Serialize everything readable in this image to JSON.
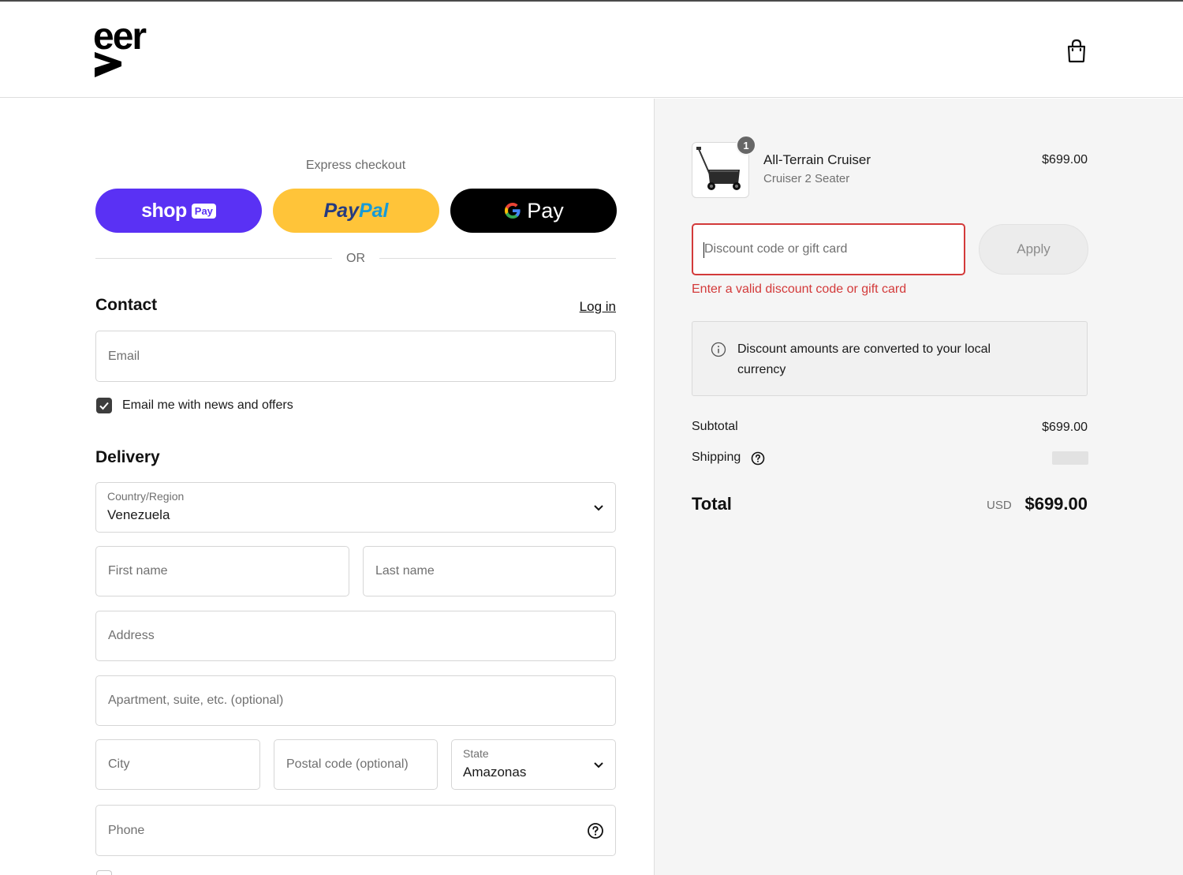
{
  "header": {
    "logo_text": "veer",
    "cart_icon": "shopping-bag-icon"
  },
  "express": {
    "title": "Express checkout",
    "shop_pay": {
      "word": "shop",
      "badge": "Pay",
      "color": "#5a31f4"
    },
    "paypal": {
      "part1": "Pay",
      "part2": "Pal",
      "color": "#ffc439"
    },
    "gpay": {
      "word": "Pay",
      "color": "#000000"
    },
    "divider_text": "OR"
  },
  "contact": {
    "title": "Contact",
    "login_link": "Log in",
    "email_placeholder": "Email",
    "newsletter_label": "Email me with news and offers",
    "newsletter_checked": true
  },
  "delivery": {
    "title": "Delivery",
    "country_label": "Country/Region",
    "country_value": "Venezuela",
    "first_name_placeholder": "First name",
    "last_name_placeholder": "Last name",
    "address_placeholder": "Address",
    "apartment_placeholder": "Apartment, suite, etc. (optional)",
    "city_placeholder": "City",
    "postal_placeholder": "Postal code (optional)",
    "state_label": "State",
    "state_value": "Amazonas",
    "phone_placeholder": "Phone"
  },
  "summary": {
    "product": {
      "name": "All-Terrain Cruiser",
      "variant": "Cruiser 2 Seater",
      "price": "$699.00",
      "quantity": "1"
    },
    "discount": {
      "placeholder": "Discount code or gift card",
      "apply_label": "Apply",
      "error": "Enter a valid discount code or gift card"
    },
    "info": "Discount amounts are converted to your local currency",
    "subtotal_label": "Subtotal",
    "subtotal_value": "$699.00",
    "shipping_label": "Shipping",
    "total_label": "Total",
    "total_currency": "USD",
    "total_value": "$699.00"
  },
  "colors": {
    "error": "#d33a3a",
    "summary_bg": "#f5f5f5"
  }
}
